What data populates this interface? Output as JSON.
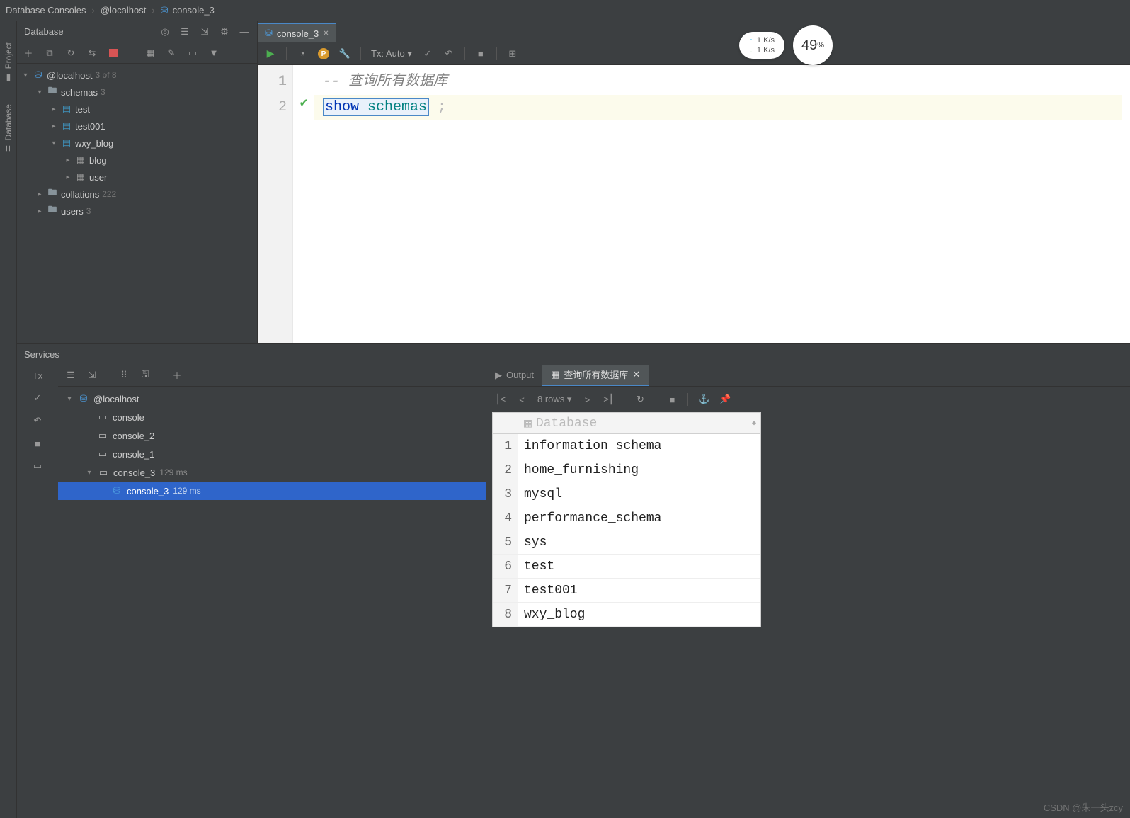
{
  "breadcrumb": {
    "item1": "Database Consoles",
    "item2": "@localhost",
    "item3": "console_3"
  },
  "gutter": {
    "project": "Project",
    "database": "Database"
  },
  "db_panel": {
    "title": "Database",
    "connection": "@localhost",
    "connection_badge": "3 of 8",
    "schemas": {
      "label": "schemas",
      "count": "3",
      "items": [
        {
          "name": "test"
        },
        {
          "name": "test001"
        },
        {
          "name": "wxy_blog",
          "tables": [
            "blog",
            "user"
          ]
        }
      ]
    },
    "collations": {
      "label": "collations",
      "count": "222"
    },
    "users": {
      "label": "users",
      "count": "3"
    }
  },
  "editor": {
    "tab": "console_3",
    "tx_label": "Tx: Auto",
    "line1_comment": "-- 查询所有数据库",
    "line2_kw": "show",
    "line2_ident": "schemas",
    "line2_rest": " ;",
    "line_nums": [
      "1",
      "2"
    ]
  },
  "metrics": {
    "up": "1  K/s",
    "down": "1  K/s",
    "pct": "49",
    "pct_suffix": "%"
  },
  "services": {
    "title": "Services",
    "tx_label": "Tx",
    "host": "@localhost",
    "consoles": [
      "console",
      "console_2",
      "console_1"
    ],
    "console3_group": "console_3",
    "console3_item": "console_3",
    "time": "129 ms"
  },
  "results": {
    "output_tab": "Output",
    "query_tab": "查询所有数据库",
    "rows_label": "8 rows",
    "column": "Database",
    "data": [
      "information_schema",
      "home_furnishing",
      "mysql",
      "performance_schema",
      "sys",
      "test",
      "test001",
      "wxy_blog"
    ]
  },
  "watermark": "CSDN @朱一头zcy"
}
